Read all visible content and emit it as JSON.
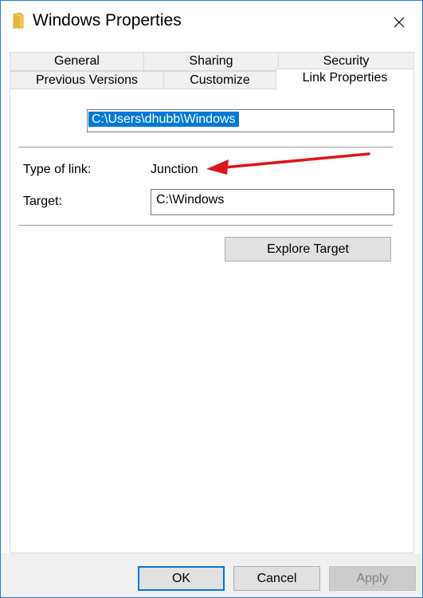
{
  "window": {
    "title": "Windows Properties",
    "title_icon": "folder-link-icon",
    "close_icon": "close-icon"
  },
  "tabs": {
    "row1": [
      {
        "label": "General"
      },
      {
        "label": "Sharing"
      },
      {
        "label": "Security"
      }
    ],
    "row2": [
      {
        "label": "Previous Versions"
      },
      {
        "label": "Customize"
      },
      {
        "label": "Link Properties",
        "active": true
      }
    ]
  },
  "link_properties": {
    "path_value": "C:\\Users\\dhubb\\Windows",
    "type_label": "Type of link:",
    "type_value": "Junction",
    "target_label": "Target:",
    "target_value": "C:\\Windows",
    "explore_button": "Explore Target",
    "annotation": "red-arrow-pointing-to-junction"
  },
  "footer": {
    "ok": "OK",
    "cancel": "Cancel",
    "apply": "Apply"
  },
  "colors": {
    "accent": "#0078d7",
    "window_border": "#2b79d6",
    "annotation_arrow": "#e0141e",
    "folder_icon": "#f4c94c"
  }
}
